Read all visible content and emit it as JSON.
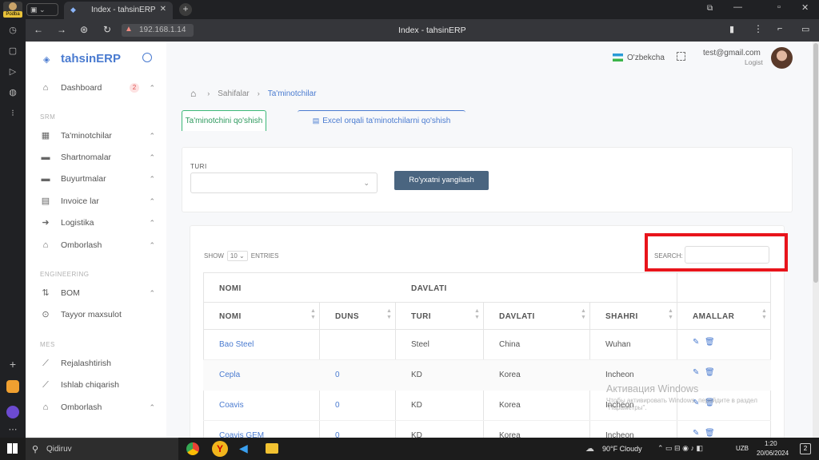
{
  "browser": {
    "profile_badge": "Podba",
    "tab_title": "Index - tahsinERP",
    "address": "192.168.1.14",
    "page_title": "Index - tahsinERP"
  },
  "app": {
    "brand": "tahsinERP",
    "language": "O'zbekcha",
    "user_email": "test@gmail.com",
    "user_role": "Logist"
  },
  "sidebar": {
    "dashboard": "Dashboard",
    "dashboard_badge": "2",
    "srm": "SRM",
    "srm_items": [
      "Ta'minotchilar",
      "Shartnomalar",
      "Buyurtmalar",
      "Invoice lar",
      "Logistika",
      "Omborlash"
    ],
    "engineering": "ENGINEERING",
    "eng_items": [
      "BOM",
      "Tayyor maxsulot"
    ],
    "mes": "MES",
    "mes_items": [
      "Rejalashtirish",
      "Ishlab chiqarish",
      "Omborlash"
    ]
  },
  "breadcrumb": {
    "level1": "Sahifalar",
    "level2": "Ta'minotchilar"
  },
  "actions": {
    "add_supplier": "Ta'minotchini qo'shish",
    "excel_import": "Excel orqali ta'minotchilarni qo'shish"
  },
  "filter": {
    "label": "TURI",
    "refresh": "Ro'yxatni yangilash"
  },
  "table": {
    "show": "SHOW",
    "page_size": "10",
    "entries": "ENTRIES",
    "search_label": "SEARCH:",
    "group_headers": [
      "NOMI",
      "DAVLATI"
    ],
    "columns": [
      "NOMI",
      "DUNS",
      "TURI",
      "DAVLATI",
      "SHAHRI",
      "AMALLAR"
    ],
    "rows": [
      {
        "name": "Bao Steel",
        "duns": "",
        "type": "Steel",
        "country": "China",
        "city": "Wuhan"
      },
      {
        "name": "Cepla",
        "duns": "0",
        "type": "KD",
        "country": "Korea",
        "city": "Incheon"
      },
      {
        "name": "Coavis",
        "duns": "0",
        "type": "KD",
        "country": "Korea",
        "city": "Incheon"
      },
      {
        "name": "Coavis GEM",
        "duns": "0",
        "type": "KD",
        "country": "Korea",
        "city": "Incheon"
      }
    ]
  },
  "watermark": {
    "title": "Активация Windows",
    "line1": "Чтобы активировать Windows, перейдите в раздел",
    "line2": "\"Параметры\"."
  },
  "taskbar": {
    "search": "Qidiruv",
    "weather": "90°F Cloudy",
    "lang": "UZB",
    "time": "1:20",
    "date": "20/06/2024",
    "notif": "2"
  },
  "colors": {
    "accent": "#4a7bd0",
    "refresh_button": "#4a6580",
    "highlight": "#e8141b",
    "add_border": "#3cb878"
  }
}
